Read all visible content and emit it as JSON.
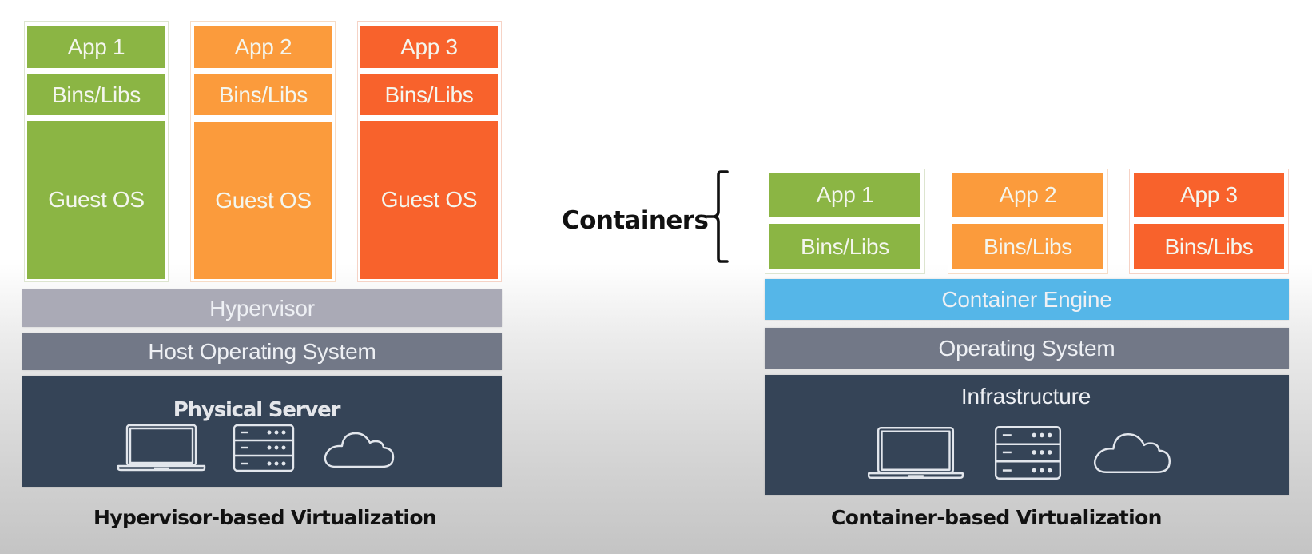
{
  "colors": {
    "green": "#8bb544",
    "orange": "#fb9b3c",
    "red": "#f8622c",
    "hypervisor": "#aaaab6",
    "operating_system": "#727887",
    "hardware": "#354457",
    "container_engine": "#55b6e8",
    "caption_text": "#111111"
  },
  "hypervisor_diagram": {
    "caption": "Hypervisor-based Virtualization",
    "vms": [
      {
        "app": "App 1",
        "libs": "Bins/Libs",
        "os": "Guest OS",
        "color": "green"
      },
      {
        "app": "App 2",
        "libs": "Bins/Libs",
        "os": "Guest OS",
        "color": "orange"
      },
      {
        "app": "App 3",
        "libs": "Bins/Libs",
        "os": "Guest OS",
        "color": "red"
      }
    ],
    "hypervisor": "Hypervisor",
    "host_os": "Host Operating System",
    "hardware": {
      "label": "Physical Server",
      "icons": [
        "laptop-icon",
        "server-rack-icon",
        "cloud-icon"
      ]
    }
  },
  "container_diagram": {
    "caption": "Container-based Virtualization",
    "brace_label": "Containers",
    "containers": [
      {
        "app": "App 1",
        "libs": "Bins/Libs",
        "color": "green"
      },
      {
        "app": "App 2",
        "libs": "Bins/Libs",
        "color": "orange"
      },
      {
        "app": "App 3",
        "libs": "Bins/Libs",
        "color": "red"
      }
    ],
    "engine": "Container Engine",
    "os": "Operating System",
    "hardware": {
      "label": "Infrastructure",
      "icons": [
        "laptop-icon",
        "server-rack-icon",
        "cloud-icon"
      ]
    }
  }
}
